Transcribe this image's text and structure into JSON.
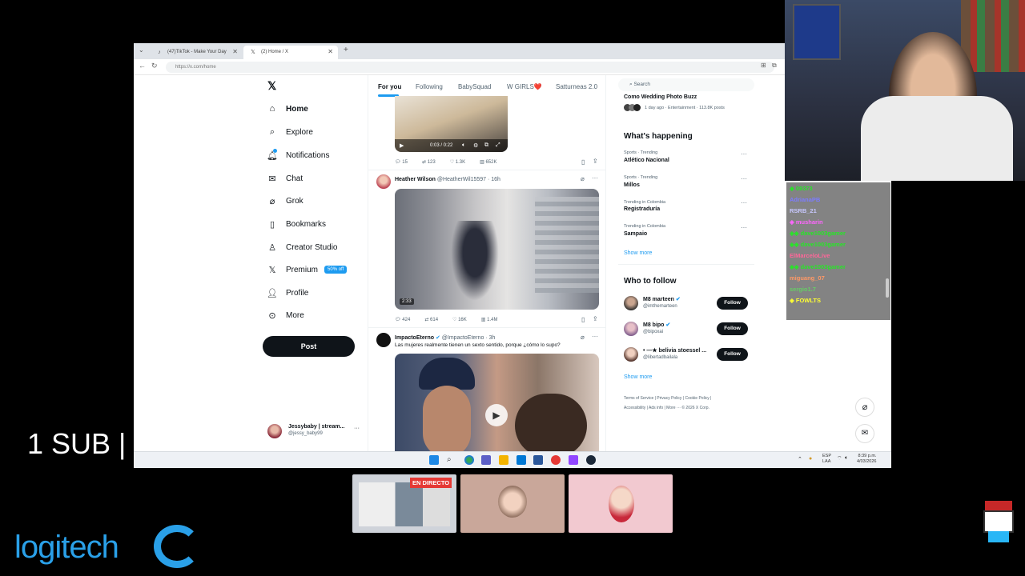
{
  "browser": {
    "tabs": [
      {
        "title": "(47)TikTok - Make Your Day",
        "icon": "tiktok-icon"
      },
      {
        "title": "(2) Home / X",
        "icon": "x-logo-icon"
      }
    ],
    "url": "https://x.com/home"
  },
  "nav": {
    "items": [
      {
        "label": "Home",
        "icon": "home-icon"
      },
      {
        "label": "Explore",
        "icon": "search-icon"
      },
      {
        "label": "Notifications",
        "icon": "bell-icon"
      },
      {
        "label": "Chat",
        "icon": "mail-icon"
      },
      {
        "label": "Grok",
        "icon": "grok-icon"
      },
      {
        "label": "Bookmarks",
        "icon": "bookmark-icon"
      },
      {
        "label": "Creator Studio",
        "icon": "creator-icon"
      },
      {
        "label": "Premium",
        "icon": "x-logo-icon",
        "badge": "50% off"
      },
      {
        "label": "Profile",
        "icon": "person-icon"
      },
      {
        "label": "More",
        "icon": "more-icon"
      }
    ],
    "post_label": "Post",
    "account": {
      "name": "Jessybaby | stream...",
      "handle": "@jessy_baby99"
    }
  },
  "feed": {
    "tabs": [
      "For you",
      "Following",
      "BabySquad",
      "W GIRLS❤️",
      "Satturneas 2.0"
    ],
    "tweet0": {
      "video_time": "0:03 / 0:22",
      "stats": {
        "replies": "15",
        "retweets": "123",
        "likes": "1.3K",
        "views": "652K"
      }
    },
    "tweet1": {
      "name": "Heather Wilson",
      "handle": "@HeatherW...",
      "handle_full": "@HeatherWil15597 · 16h",
      "duration": "2:33",
      "stats": {
        "replies": "424",
        "retweets": "614",
        "likes": "16K",
        "views": "1.4M"
      }
    },
    "tweet2": {
      "name": "ImpactoEterno",
      "handle_full": "@ImpactoEterno · 3h",
      "text": "Las mujeres realmente tienen un sexto sentido, porque ¿cómo lo supo?"
    }
  },
  "sidebar": {
    "search_placeholder": "Search",
    "top_item": {
      "title": "Como Wedding Photo Buzz",
      "meta": "1 day ago · Entertainment · 113.8K posts"
    },
    "whats_happening": "What's happening",
    "trends": [
      {
        "category": "Sports · Trending",
        "name": "Atlético Nacional"
      },
      {
        "category": "Sports · Trending",
        "name": "Millos"
      },
      {
        "category": "Trending in Colombia",
        "name": "Registraduría"
      },
      {
        "category": "Trending in Colombia",
        "name": "Sampaio"
      }
    ],
    "show_more": "Show more",
    "who_to_follow": "Who to follow",
    "follow_label": "Follow",
    "suggestions": [
      {
        "name": "M8 marteen",
        "handle": "@imthemarteen"
      },
      {
        "name": "M8 bipo",
        "handle": "@bipoxai"
      },
      {
        "name": "• —★ belivia stoessel ...",
        "handle": "@libertadbailala"
      }
    ],
    "footer_line1": "Terms of Service  |  Privacy Policy  |  Cookie Policy  |",
    "footer_line2": "Accessibility  |  Ads info  |  More ···  © 2026 X Corp."
  },
  "taskbar": {
    "lang": "ESP",
    "lang2": "LAA",
    "time": "8:39 p.m.",
    "date": "4/03/2026"
  },
  "chat": {
    "lines": [
      {
        "name": "09373",
        "color": "#28e428"
      },
      {
        "name": "AdrianaPB",
        "color": "#7c7cff"
      },
      {
        "name": "RSRB_21",
        "color": "#c8c8ff"
      },
      {
        "name": "musharin",
        "color": "#ff66ff"
      },
      {
        "name": "dave1003gamer",
        "color": "#28e428"
      },
      {
        "name": "dave1003gamer",
        "color": "#28e428"
      },
      {
        "name": "ElMarceloLive",
        "color": "#ff6699"
      },
      {
        "name": "dave1003gamer",
        "color": "#28e428"
      },
      {
        "name": "miguang_07",
        "color": "#ff9966"
      },
      {
        "name": "sergio1.7",
        "color": "#66cc66"
      },
      {
        "name": "FOWLTS",
        "color": "#ffff33"
      }
    ]
  },
  "overlay": {
    "sub_text": "1 SUB |",
    "logitech": "logitech",
    "live_badge": "EN DIRECTO"
  }
}
